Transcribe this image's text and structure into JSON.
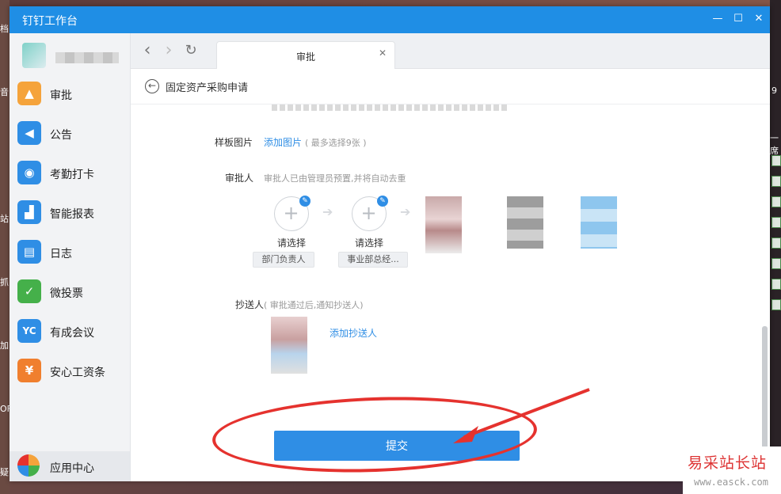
{
  "window": {
    "title": "钉钉工作台"
  },
  "sidebar": {
    "items": [
      {
        "label": "审批",
        "icon": "approval-icon",
        "color": "#f5a33b",
        "glyph": "审"
      },
      {
        "label": "公告",
        "icon": "announcement-icon",
        "color": "#2f8ee5",
        "glyph": "◀"
      },
      {
        "label": "考勤打卡",
        "icon": "attendance-icon",
        "color": "#2f8ee5",
        "glyph": "◉"
      },
      {
        "label": "智能报表",
        "icon": "report-icon",
        "color": "#2f8ee5",
        "glyph": "▟"
      },
      {
        "label": "日志",
        "icon": "log-icon",
        "color": "#2f8ee5",
        "glyph": "▤"
      },
      {
        "label": "微投票",
        "icon": "vote-icon",
        "color": "#45b04a",
        "glyph": "✓"
      },
      {
        "label": "有成会议",
        "icon": "meeting-icon",
        "color": "#2f8ee5",
        "glyph": "YC"
      },
      {
        "label": "安心工资条",
        "icon": "payslip-icon",
        "color": "#f07f2e",
        "glyph": "¥"
      }
    ],
    "app_center": {
      "label": "应用中心",
      "icon": "app-center-icon"
    }
  },
  "tab": {
    "label": "审批"
  },
  "page": {
    "title": "固定资产采购申请"
  },
  "form": {
    "sample_image": {
      "label": "样板图片",
      "action": "添加图片",
      "hint": "( 最多选择9张 )"
    },
    "approver": {
      "label": "审批人",
      "hint": "审批人已由管理员预置,并将自动去重",
      "steps": [
        {
          "select_label": "请选择",
          "tag": "部门负责人"
        },
        {
          "select_label": "请选择",
          "tag": "事业部总经..."
        }
      ]
    },
    "cc": {
      "label": "抄送人",
      "hint": "( 审批通过后,通知抄送人)",
      "action": "添加抄送人"
    },
    "submit_label": "提交"
  },
  "desktop": {
    "left_labels": [
      "档",
      "音",
      "站",
      "抓",
      "加",
      "旗",
      "OF",
      "疑"
    ],
    "right_labels": [
      "9",
      "一席"
    ]
  },
  "watermark": {
    "brand": "易采站长站",
    "url": "www.easck.com"
  },
  "colors": {
    "accent": "#2f8ee5",
    "titlebar": "#1f8ee5",
    "annotation": "#e5322e"
  }
}
